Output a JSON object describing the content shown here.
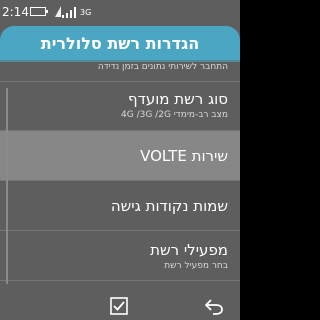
{
  "status_bar": {
    "time": "2:14",
    "network_type": "3G",
    "icons": [
      "battery-icon",
      "sim-icon",
      "signal-icon"
    ]
  },
  "header": {
    "title": "הגדרות רשת סלולרית",
    "color": "#4aa6c2"
  },
  "list": {
    "items": [
      {
        "title": "",
        "subtitle": "התחבר לשירותי נתונים בזמן נדידה",
        "partial": true
      },
      {
        "title": "סוג רשת מועדף",
        "subtitle": "מצב רב-מימדי 4G /3G /2G"
      },
      {
        "title": "שירות VOLTE",
        "subtitle": "",
        "selected": true
      },
      {
        "title": "שמות נקודות גישה",
        "subtitle": ""
      },
      {
        "title": "מפעילי רשת",
        "subtitle": "בחר מפעיל רשת"
      }
    ]
  },
  "softkeys": {
    "left_icon": "check-icon",
    "right_icon": "back-icon"
  }
}
